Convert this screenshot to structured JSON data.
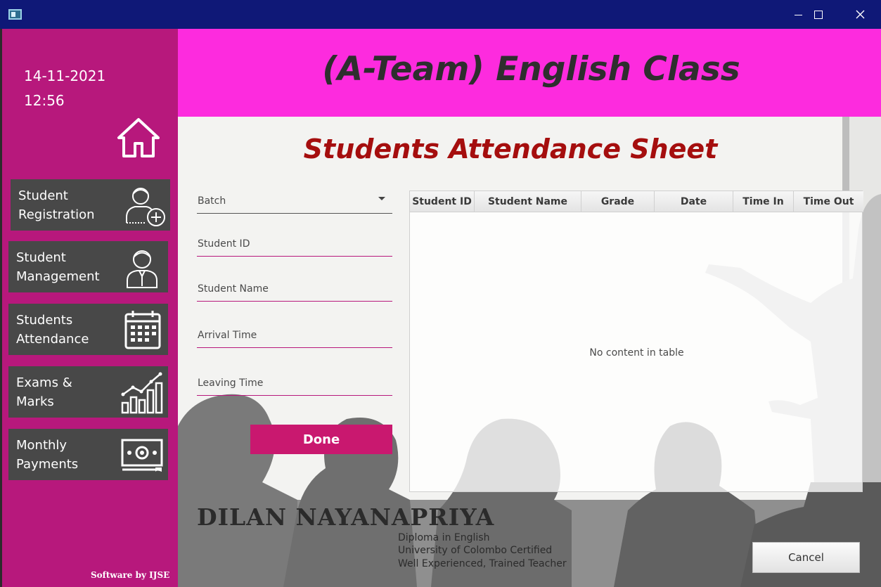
{
  "window": {
    "app_icon": "app-window-icon",
    "controls": [
      "minimize",
      "maximize",
      "close"
    ]
  },
  "sidebar": {
    "date": "14-11-2021",
    "time": "12:56",
    "home_icon": "home-icon",
    "items": [
      {
        "line1": "Student",
        "line2": "Registration",
        "icon": "add-user-icon"
      },
      {
        "line1": "Student",
        "line2": "Management",
        "icon": "user-tie-icon"
      },
      {
        "line1": "Students",
        "line2": "Attendance",
        "icon": "calendar-icon"
      },
      {
        "line1": "Exams &",
        "line2": "Marks",
        "icon": "bar-chart-icon"
      },
      {
        "line1": "Monthly",
        "line2": "Payments",
        "icon": "money-icon"
      }
    ],
    "footer": "Software by IJSE"
  },
  "header": {
    "title": "(A-Team) English Class",
    "bg_color": "#fd2bde"
  },
  "form": {
    "title": "Students Attendance Sheet",
    "batch_label": "Batch",
    "student_id_label": "Student ID",
    "student_name_label": "Student Name",
    "arrival_label": "Arrival Time",
    "leaving_label": "Leaving Time",
    "done_label": "Done"
  },
  "table": {
    "columns": [
      "Student ID",
      "Student Name",
      "Grade",
      "Date",
      "Time In",
      "Time Out"
    ],
    "rows": [],
    "empty_message": "No content in table"
  },
  "teacher": {
    "name": "Dilan Nayanapriya",
    "qualifications": [
      "Diploma in English",
      "University of Colombo Certified",
      "Well Experienced, Trained Teacher"
    ]
  },
  "actions": {
    "cancel_label": "Cancel"
  },
  "colors": {
    "sidebar": "#b7187c",
    "nav_item": "#484848",
    "title_red": "#a50e0e",
    "accent": "#c9186f",
    "titlebar": "#0f1877"
  }
}
